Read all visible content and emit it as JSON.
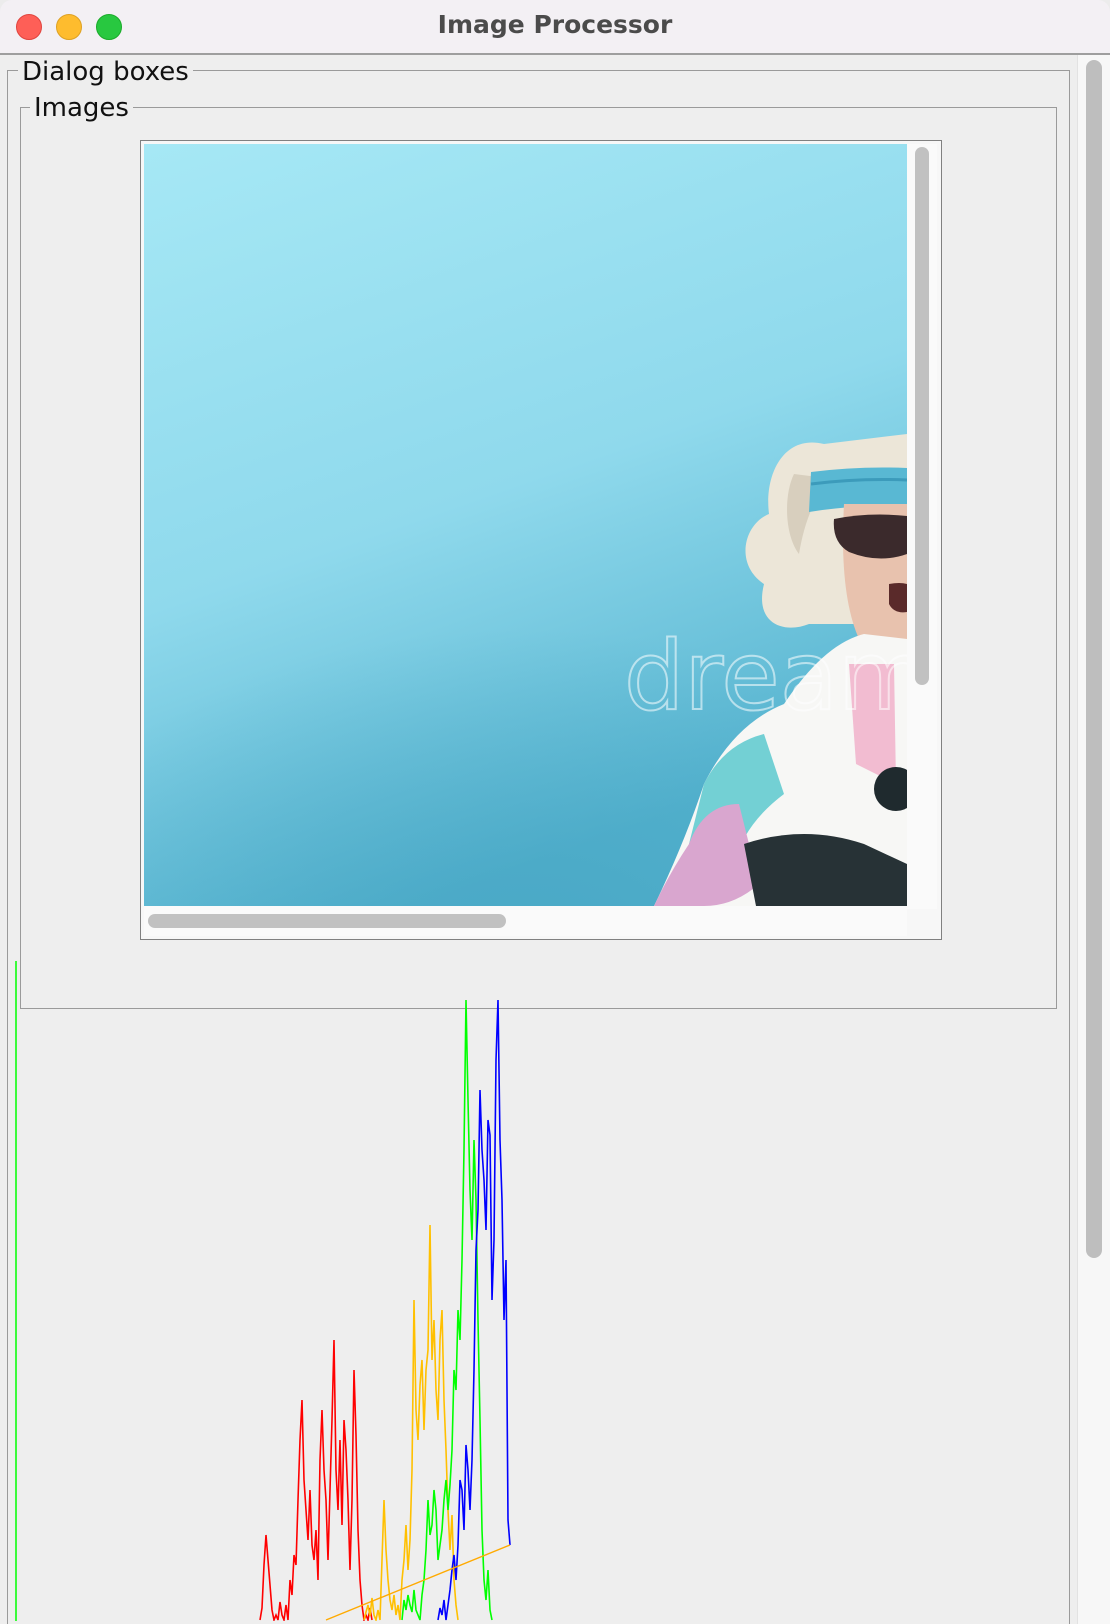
{
  "window": {
    "title": "Image Processor"
  },
  "panels": {
    "dialog_boxes_legend": "Dialog boxes",
    "images_legend": "Images"
  },
  "image_view": {
    "watermark": "dream",
    "horizontal_scroll_fraction": 0,
    "vertical_scroll_fraction": 0
  },
  "histogram": {
    "colors": {
      "red": "#ff0000",
      "orange": "#ffc000",
      "green": "#00ff00",
      "blue": "#0000ff",
      "line": "#ffaa00"
    }
  },
  "chart_data": {
    "type": "line",
    "title": "",
    "xlabel": "",
    "ylabel": "",
    "series": [
      {
        "color": "red",
        "values": [
          [
            246,
            0
          ],
          [
            248,
            12
          ],
          [
            250,
            55
          ],
          [
            252,
            85
          ],
          [
            254,
            60
          ],
          [
            256,
            35
          ],
          [
            258,
            10
          ],
          [
            260,
            0
          ],
          [
            262,
            5
          ],
          [
            264,
            0
          ],
          [
            266,
            18
          ],
          [
            268,
            5
          ],
          [
            270,
            0
          ],
          [
            272,
            15
          ],
          [
            274,
            0
          ],
          [
            276,
            40
          ],
          [
            278,
            25
          ],
          [
            280,
            65
          ],
          [
            282,
            55
          ],
          [
            284,
            120
          ],
          [
            286,
            180
          ],
          [
            288,
            220
          ],
          [
            290,
            140
          ],
          [
            292,
            110
          ],
          [
            294,
            80
          ],
          [
            296,
            130
          ],
          [
            298,
            75
          ],
          [
            300,
            60
          ],
          [
            302,
            90
          ],
          [
            304,
            40
          ],
          [
            306,
            160
          ],
          [
            308,
            210
          ],
          [
            310,
            150
          ],
          [
            312,
            120
          ],
          [
            314,
            60
          ],
          [
            316,
            130
          ],
          [
            318,
            200
          ],
          [
            320,
            280
          ],
          [
            322,
            150
          ],
          [
            324,
            110
          ],
          [
            326,
            180
          ],
          [
            328,
            95
          ],
          [
            330,
            200
          ],
          [
            332,
            170
          ],
          [
            334,
            120
          ],
          [
            336,
            50
          ],
          [
            338,
            120
          ],
          [
            340,
            250
          ],
          [
            342,
            185
          ],
          [
            344,
            90
          ],
          [
            346,
            40
          ],
          [
            348,
            15
          ],
          [
            350,
            0
          ],
          [
            352,
            5
          ],
          [
            354,
            0
          ],
          [
            356,
            12
          ],
          [
            358,
            0
          ]
        ]
      },
      {
        "color": "orange",
        "values": [
          [
            350,
            0
          ],
          [
            352,
            8
          ],
          [
            354,
            15
          ],
          [
            356,
            4
          ],
          [
            358,
            22
          ],
          [
            360,
            5
          ],
          [
            362,
            0
          ],
          [
            364,
            10
          ],
          [
            366,
            0
          ],
          [
            368,
            60
          ],
          [
            370,
            120
          ],
          [
            372,
            70
          ],
          [
            374,
            40
          ],
          [
            376,
            20
          ],
          [
            378,
            10
          ],
          [
            380,
            25
          ],
          [
            382,
            5
          ],
          [
            384,
            15
          ],
          [
            386,
            0
          ],
          [
            388,
            40
          ],
          [
            390,
            60
          ],
          [
            392,
            95
          ],
          [
            394,
            50
          ],
          [
            396,
            80
          ],
          [
            398,
            150
          ],
          [
            400,
            320
          ],
          [
            402,
            210
          ],
          [
            404,
            180
          ],
          [
            406,
            235
          ],
          [
            408,
            260
          ],
          [
            410,
            190
          ],
          [
            412,
            250
          ],
          [
            414,
            270
          ],
          [
            416,
            395
          ],
          [
            418,
            260
          ],
          [
            420,
            300
          ],
          [
            422,
            230
          ],
          [
            424,
            200
          ],
          [
            426,
            280
          ],
          [
            428,
            310
          ],
          [
            430,
            220
          ],
          [
            432,
            170
          ],
          [
            434,
            110
          ],
          [
            436,
            70
          ],
          [
            438,
            105
          ],
          [
            440,
            40
          ],
          [
            442,
            15
          ],
          [
            444,
            0
          ]
        ]
      },
      {
        "color": "green",
        "values": [
          [
            388,
            0
          ],
          [
            390,
            20
          ],
          [
            392,
            10
          ],
          [
            394,
            25
          ],
          [
            396,
            15
          ],
          [
            398,
            8
          ],
          [
            400,
            30
          ],
          [
            402,
            10
          ],
          [
            404,
            5
          ],
          [
            406,
            0
          ],
          [
            408,
            25
          ],
          [
            410,
            40
          ],
          [
            412,
            70
          ],
          [
            414,
            120
          ],
          [
            416,
            85
          ],
          [
            418,
            95
          ],
          [
            420,
            130
          ],
          [
            422,
            110
          ],
          [
            424,
            60
          ],
          [
            426,
            75
          ],
          [
            428,
            90
          ],
          [
            430,
            120
          ],
          [
            432,
            140
          ],
          [
            434,
            110
          ],
          [
            436,
            135
          ],
          [
            438,
            170
          ],
          [
            440,
            250
          ],
          [
            442,
            230
          ],
          [
            444,
            310
          ],
          [
            446,
            280
          ],
          [
            448,
            360
          ],
          [
            450,
            470
          ],
          [
            452,
            620
          ],
          [
            454,
            520
          ],
          [
            456,
            430
          ],
          [
            458,
            380
          ],
          [
            460,
            480
          ],
          [
            462,
            420
          ],
          [
            464,
            300
          ],
          [
            466,
            200
          ],
          [
            468,
            90
          ],
          [
            470,
            40
          ],
          [
            472,
            20
          ],
          [
            474,
            50
          ],
          [
            476,
            10
          ],
          [
            478,
            0
          ]
        ]
      },
      {
        "color": "blue",
        "values": [
          [
            424,
            0
          ],
          [
            426,
            12
          ],
          [
            428,
            5
          ],
          [
            430,
            20
          ],
          [
            432,
            0
          ],
          [
            434,
            15
          ],
          [
            436,
            30
          ],
          [
            438,
            50
          ],
          [
            440,
            65
          ],
          [
            442,
            40
          ],
          [
            444,
            75
          ],
          [
            446,
            140
          ],
          [
            448,
            130
          ],
          [
            450,
            90
          ],
          [
            452,
            175
          ],
          [
            454,
            150
          ],
          [
            456,
            110
          ],
          [
            458,
            160
          ],
          [
            460,
            250
          ],
          [
            462,
            370
          ],
          [
            464,
            410
          ],
          [
            466,
            530
          ],
          [
            468,
            470
          ],
          [
            470,
            440
          ],
          [
            472,
            390
          ],
          [
            474,
            500
          ],
          [
            476,
            485
          ],
          [
            478,
            320
          ],
          [
            480,
            380
          ],
          [
            482,
            560
          ],
          [
            484,
            620
          ],
          [
            486,
            480
          ],
          [
            488,
            420
          ],
          [
            490,
            300
          ],
          [
            492,
            360
          ],
          [
            494,
            100
          ],
          [
            496,
            75
          ]
        ]
      },
      {
        "color": "line",
        "values": [
          [
            312,
            0
          ],
          [
            496,
            75
          ]
        ]
      }
    ]
  }
}
